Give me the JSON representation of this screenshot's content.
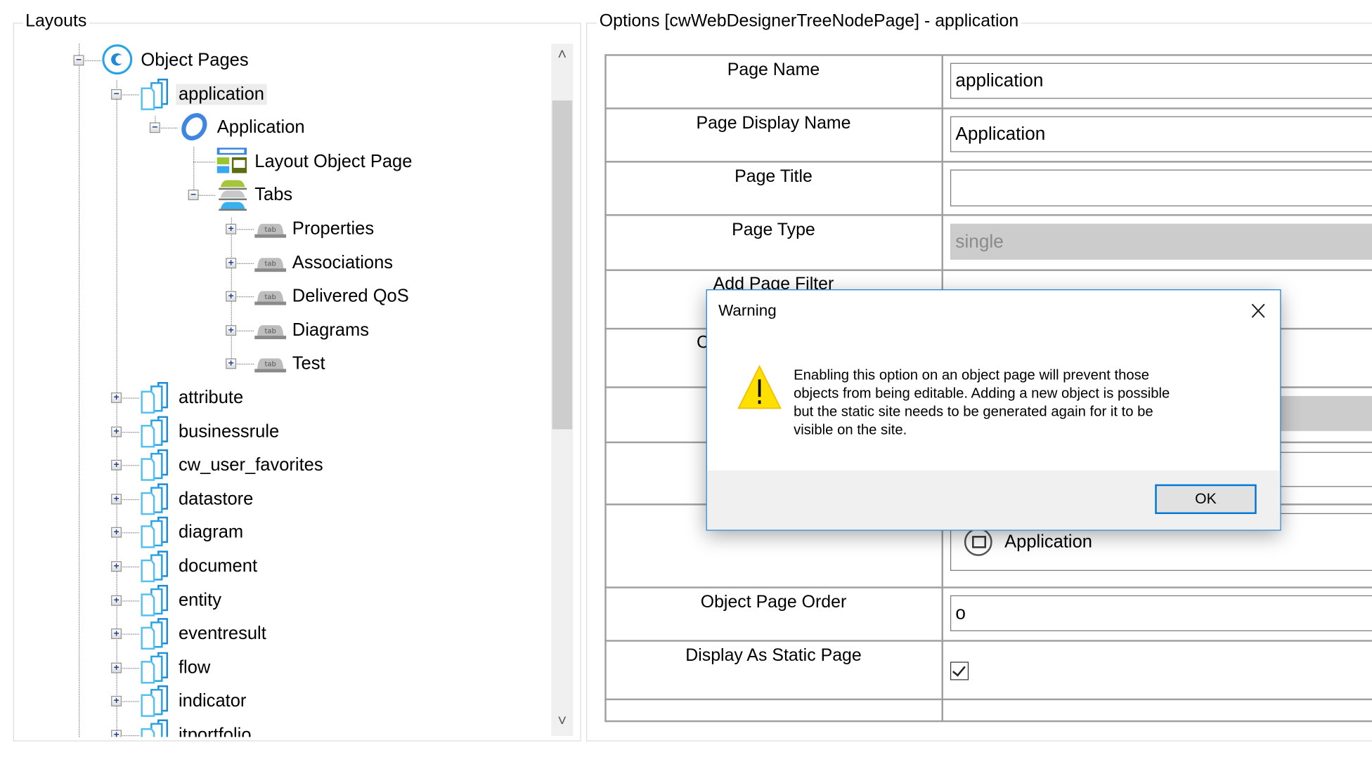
{
  "layouts": {
    "title": "Layouts",
    "tree": [
      {
        "label": "Object Pages",
        "level": 0,
        "icon": "object-pages-icon",
        "expander": "minus"
      },
      {
        "label": "application",
        "level": 1,
        "icon": "pages-icon",
        "expander": "minus",
        "selected": true
      },
      {
        "label": "Application",
        "level": 2,
        "icon": "object-ring-icon",
        "expander": "minus"
      },
      {
        "label": "Layout Object Page",
        "level": 3,
        "icon": "layout-icon",
        "expander": ""
      },
      {
        "label": "Tabs",
        "level": 3,
        "icon": "tabs-stack-icon",
        "expander": "minus"
      },
      {
        "label": "Properties",
        "level": 4,
        "icon": "tab-icon",
        "expander": "plus"
      },
      {
        "label": "Associations",
        "level": 4,
        "icon": "tab-icon",
        "expander": "plus"
      },
      {
        "label": "Delivered QoS",
        "level": 4,
        "icon": "tab-icon",
        "expander": "plus"
      },
      {
        "label": "Diagrams",
        "level": 4,
        "icon": "tab-icon",
        "expander": "plus"
      },
      {
        "label": "Test",
        "level": 4,
        "icon": "tab-icon",
        "expander": "plus"
      },
      {
        "label": "attribute",
        "level": 1,
        "icon": "pages-icon",
        "expander": "plus"
      },
      {
        "label": "businessrule",
        "level": 1,
        "icon": "pages-icon",
        "expander": "plus"
      },
      {
        "label": "cw_user_favorites",
        "level": 1,
        "icon": "pages-icon",
        "expander": "plus"
      },
      {
        "label": "datastore",
        "level": 1,
        "icon": "pages-icon",
        "expander": "plus"
      },
      {
        "label": "diagram",
        "level": 1,
        "icon": "pages-icon",
        "expander": "plus"
      },
      {
        "label": "document",
        "level": 1,
        "icon": "pages-icon",
        "expander": "plus"
      },
      {
        "label": "entity",
        "level": 1,
        "icon": "pages-icon",
        "expander": "plus"
      },
      {
        "label": "eventresult",
        "level": 1,
        "icon": "pages-icon",
        "expander": "plus"
      },
      {
        "label": "flow",
        "level": 1,
        "icon": "pages-icon",
        "expander": "plus"
      },
      {
        "label": "indicator",
        "level": 1,
        "icon": "pages-icon",
        "expander": "plus"
      },
      {
        "label": "itportfolio",
        "level": 1,
        "icon": "pages-icon",
        "expander": "plus"
      }
    ],
    "scroll_up": "˄",
    "scroll_down": "˅"
  },
  "options": {
    "title": "Options [cwWebDesignerTreeNodePage] - application",
    "fields": {
      "page_name": {
        "label": "Page Name",
        "value": "application"
      },
      "page_display_name": {
        "label": "Page Display Name",
        "value": "Application"
      },
      "page_title": {
        "label": "Page Title",
        "value": ""
      },
      "page_type": {
        "label": "Page Type",
        "value": "single"
      },
      "add_page_filter": {
        "label": "Add Page Filter"
      },
      "partial_label": "C",
      "object_type": {
        "value": "Application"
      },
      "object_page_order": {
        "label": "Object Page Order",
        "value": "o"
      },
      "display_as_static_page": {
        "label": "Display As Static Page",
        "checked": true
      }
    }
  },
  "dialog": {
    "title": "Warning",
    "icon": "warning-icon",
    "message_lines": [
      "Enabling this option on an object page will prevent those",
      "objects from being editable. Adding a new object is possible",
      "but the static site needs to be generated again for it to be",
      "visible on the site."
    ],
    "ok_label": "OK",
    "accent": "#0078d7"
  }
}
